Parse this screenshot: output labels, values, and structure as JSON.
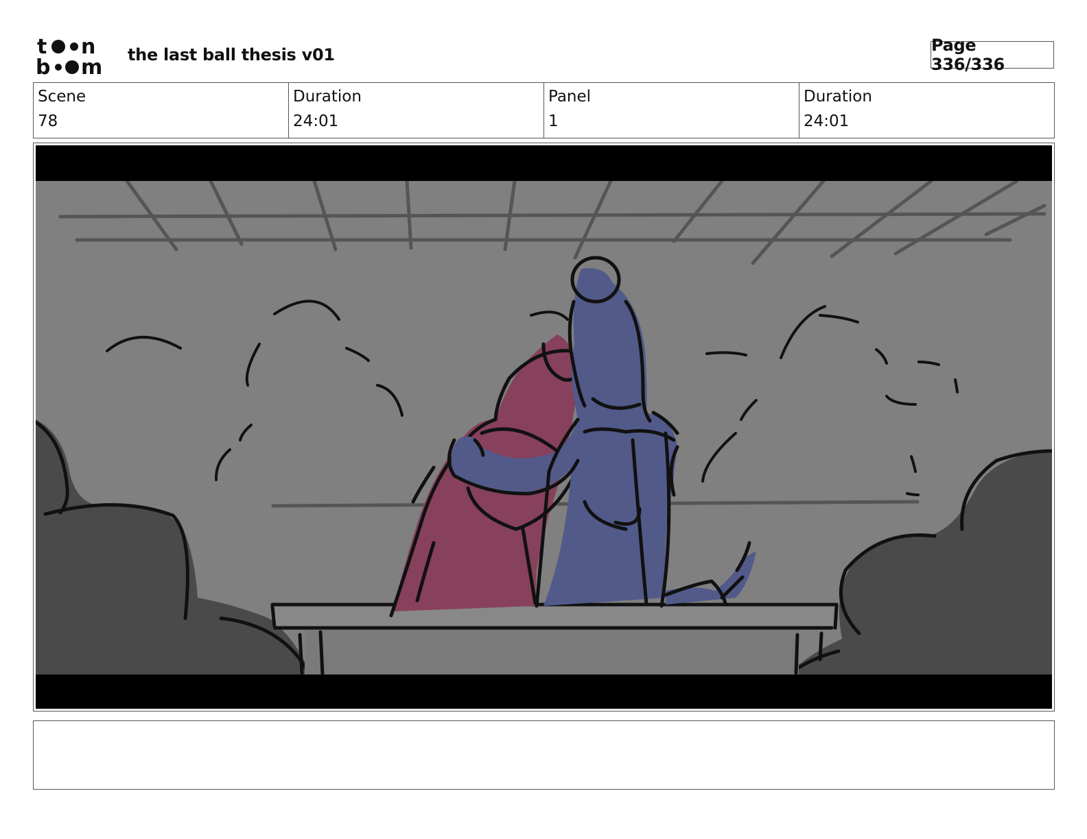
{
  "header": {
    "logo_top": "toon",
    "logo_bottom": "boom",
    "title": "the last ball thesis v01",
    "page_indicator": "Page 336/336"
  },
  "info": {
    "scene_label": "Scene",
    "scene_value": "78",
    "scene_duration_label": "Duration",
    "scene_duration_value": "24:01",
    "panel_label": "Panel",
    "panel_value": "1",
    "panel_duration_label": "Duration",
    "panel_duration_value": "24:01"
  },
  "panel_image": {
    "icon": "storyboard-drawing-couple-on-bench",
    "colors": {
      "background": "#808080",
      "bushes": "#4a4a4a",
      "letterbox": "#000000",
      "left_figure": "#87415c",
      "right_figure": "#525a8a"
    }
  },
  "notes": {
    "text": ""
  }
}
